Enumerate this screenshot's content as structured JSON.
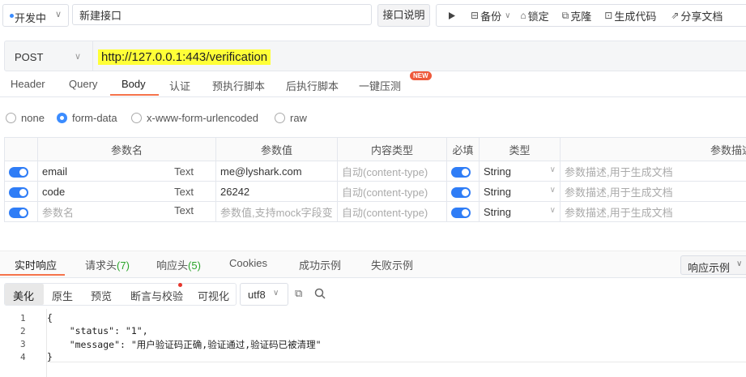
{
  "header": {
    "status": "开发中",
    "api_name": "新建接口",
    "doc_button": "接口说明",
    "toolbar": {
      "backup": "备份",
      "lock": "锁定",
      "clone": "克隆",
      "gen_code": "生成代码",
      "share_doc": "分享文档"
    }
  },
  "request": {
    "method": "POST",
    "url": "http://127.0.0.1:443/verification"
  },
  "tabs": [
    "Header",
    "Query",
    "Body",
    "认证",
    "预执行脚本",
    "后执行脚本",
    "一键压测"
  ],
  "active_tab": "Body",
  "new_badge": "NEW",
  "body_types": [
    "none",
    "form-data",
    "x-www-form-urlencoded",
    "raw"
  ],
  "selected_body_type": "form-data",
  "params_table": {
    "headers": [
      "参数名",
      "参数值",
      "内容类型",
      "必填",
      "类型",
      "参数描述"
    ],
    "rows": [
      {
        "name": "email",
        "format": "Text",
        "value": "me@lyshark.com",
        "content_type": "自动(content-type)",
        "required": true,
        "type": "String",
        "desc": "参数描述,用于生成文档"
      },
      {
        "name": "code",
        "format": "Text",
        "value": "26242",
        "content_type": "自动(content-type)",
        "required": true,
        "type": "String",
        "desc": "参数描述,用于生成文档"
      },
      {
        "name": "参数名",
        "format": "Text",
        "value": "参数值,支持mock字段变",
        "content_type": "自动(content-type)",
        "required": true,
        "type": "String",
        "desc": "参数描述,用于生成文档"
      }
    ]
  },
  "response": {
    "tabs": [
      {
        "label": "实时响应",
        "count": ""
      },
      {
        "label": "请求头",
        "count": "(7)"
      },
      {
        "label": "响应头",
        "count": "(5)"
      },
      {
        "label": "Cookies",
        "count": ""
      },
      {
        "label": "成功示例",
        "count": ""
      },
      {
        "label": "失败示例",
        "count": ""
      }
    ],
    "example_dropdown": "响应示例",
    "view_modes": [
      "美化",
      "原生",
      "预览",
      "断言与校验",
      "可视化"
    ],
    "active_view": "美化",
    "encoding": "utf8",
    "line_numbers": [
      "1",
      "2",
      "3",
      "4"
    ],
    "code_lines": [
      "{",
      "    \"status\": \"1\",",
      "    \"message\": \"用户验证码正确,验证通过,验证码已被清理\"",
      "}"
    ]
  },
  "colors": {
    "accent": "#f5734b",
    "primary": "#2f7df6",
    "url_highlight": "#ffff37",
    "badge": "#ee5a3c"
  }
}
